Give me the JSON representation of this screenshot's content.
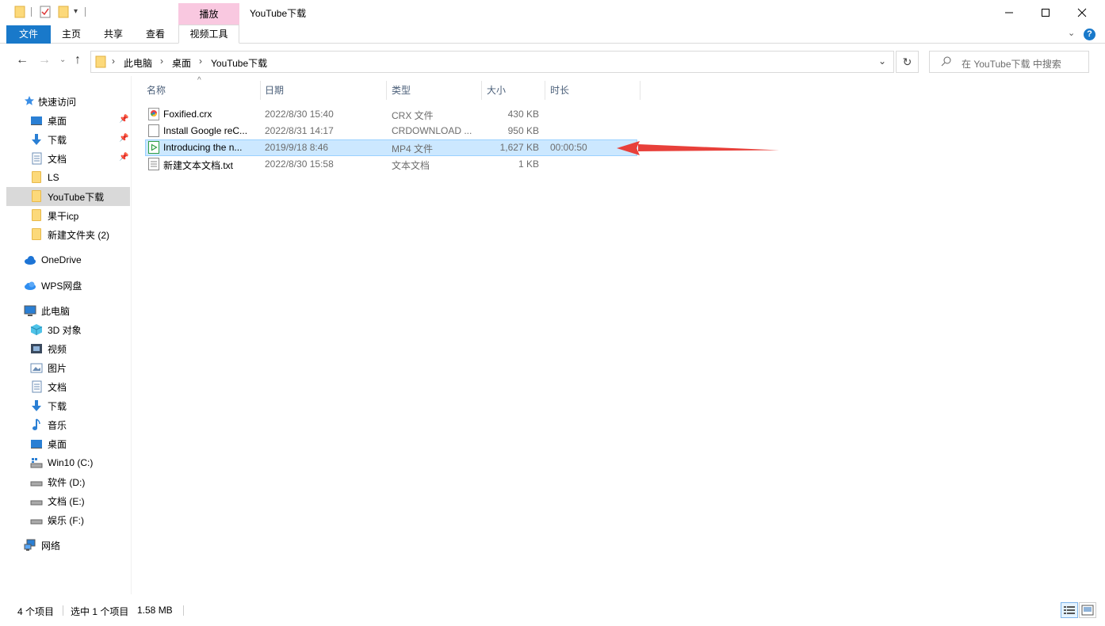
{
  "window": {
    "title": "YouTube下载",
    "context_tab_header": "播放"
  },
  "ribbon": {
    "tabs": [
      "文件",
      "主页",
      "共享",
      "查看",
      "视频工具"
    ]
  },
  "nav": {
    "breadcrumb": [
      "此电脑",
      "桌面",
      "YouTube下载"
    ],
    "search_placeholder": "在 YouTube下载 中搜索"
  },
  "sidebar": {
    "quick_access": "快速访问",
    "items": [
      {
        "label": "桌面",
        "icon": "desktop-icon",
        "pinned": true
      },
      {
        "label": "下载",
        "icon": "download-icon",
        "pinned": true
      },
      {
        "label": "文档",
        "icon": "document-icon",
        "pinned": true
      },
      {
        "label": "LS",
        "icon": "folder-icon"
      },
      {
        "label": "YouTube下载",
        "icon": "folder-icon",
        "selected": true
      },
      {
        "label": "果干icp",
        "icon": "folder-icon"
      },
      {
        "label": "新建文件夹 (2)",
        "icon": "folder-icon"
      }
    ],
    "onedrive": "OneDrive",
    "wps": "WPS网盘",
    "this_pc": "此电脑",
    "pc_items": [
      {
        "label": "3D 对象",
        "icon": "3d-objects-icon"
      },
      {
        "label": "视频",
        "icon": "video-icon"
      },
      {
        "label": "图片",
        "icon": "picture-icon"
      },
      {
        "label": "文档",
        "icon": "document-icon"
      },
      {
        "label": "下载",
        "icon": "download-icon"
      },
      {
        "label": "音乐",
        "icon": "music-icon"
      },
      {
        "label": "桌面",
        "icon": "desktop-icon"
      },
      {
        "label": "Win10 (C:)",
        "icon": "system-drive-icon"
      },
      {
        "label": "软件 (D:)",
        "icon": "drive-icon"
      },
      {
        "label": "文档 (E:)",
        "icon": "drive-icon"
      },
      {
        "label": "娱乐 (F:)",
        "icon": "drive-icon"
      }
    ],
    "network": "网络"
  },
  "columns": [
    "名称",
    "日期",
    "类型",
    "大小",
    "时长"
  ],
  "files": [
    {
      "name": "Foxified.crx",
      "date": "2022/8/30 15:40",
      "type": "CRX 文件",
      "size": "430 KB",
      "duration": "",
      "icon": "crx-file-icon"
    },
    {
      "name": "Install Google reC...",
      "date": "2022/8/31 14:17",
      "type": "CRDOWNLOAD ...",
      "size": "950 KB",
      "duration": "",
      "icon": "blank-file-icon"
    },
    {
      "name": "Introducing the n...",
      "date": "2019/9/18 8:46",
      "type": "MP4 文件",
      "size": "1,627 KB",
      "duration": "00:00:50",
      "icon": "video-file-icon",
      "selected": true
    },
    {
      "name": "新建文本文档.txt",
      "date": "2022/8/30 15:58",
      "type": "文本文档",
      "size": "1 KB",
      "duration": "",
      "icon": "text-file-icon"
    }
  ],
  "status": {
    "item_count": "4 个项目",
    "selection": "选中 1 个项目",
    "selection_size": "1.58 MB"
  },
  "colors": {
    "accent": "#1979ca",
    "selection": "#cce8ff",
    "context_tab": "#f9c8e0",
    "arrow": "#e8403a"
  }
}
